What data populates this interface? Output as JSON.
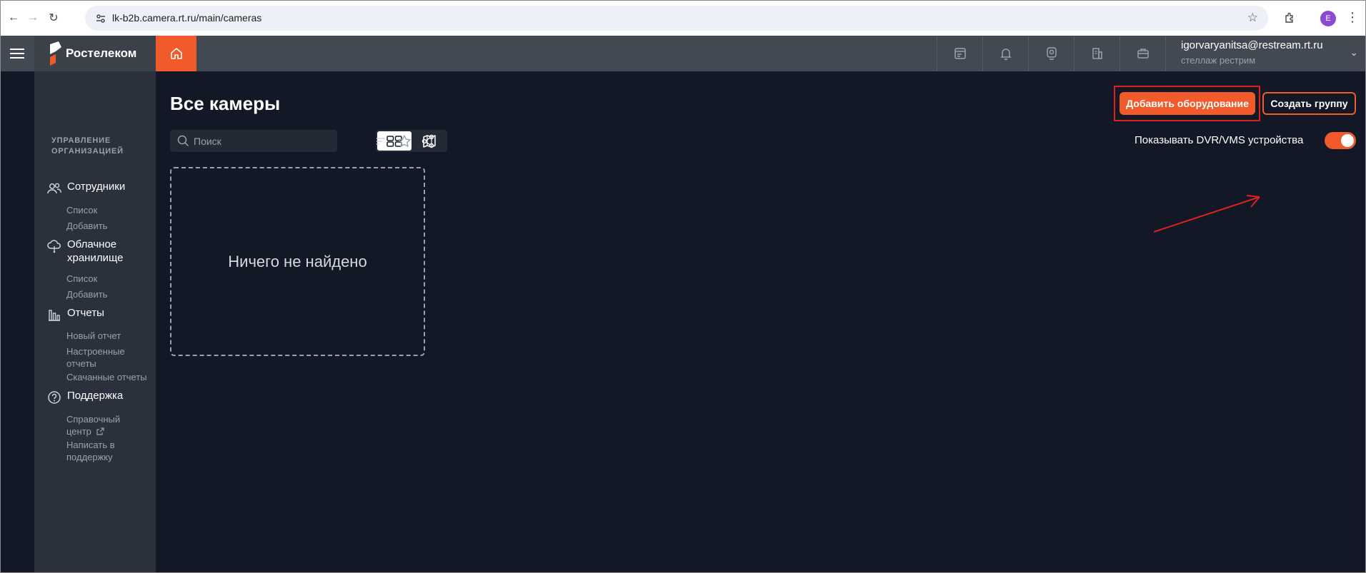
{
  "browser": {
    "url": "lk-b2b.camera.rt.ru/main/cameras",
    "profile_initial": "E"
  },
  "header": {
    "logo_text": "Ростелеком",
    "user_email": "igorvaryanitsa@restream.rt.ru",
    "user_org": "стеллаж рестрим"
  },
  "sidebar": {
    "title": "УПРАВЛЕНИЕ ОРГАНИЗАЦИЕЙ",
    "sections": [
      {
        "label": "Сотрудники",
        "icon": "users-icon",
        "links": [
          "Список",
          "Добавить"
        ]
      },
      {
        "label": "Облачное хранилище",
        "icon": "cloud-storage-icon",
        "links": [
          "Список",
          "Добавить"
        ]
      },
      {
        "label": "Отчеты",
        "icon": "reports-icon",
        "links": [
          "Новый отчет",
          "Настроенные отчеты",
          "Скачанные отчеты"
        ]
      },
      {
        "label": "Поддержка",
        "icon": "help-icon",
        "links": [
          "Справочный центр",
          "Написать в поддержку"
        ]
      }
    ]
  },
  "main": {
    "title": "Все камеры",
    "search_placeholder": "Поиск",
    "empty_text": "Ничего не найдено",
    "add_button": "Добавить оборудование",
    "group_button": "Создать группу",
    "dvr_toggle_label": "Показывать DVR/VMS устройства",
    "dvr_toggle_on": true
  },
  "colors": {
    "accent": "#f15b2b",
    "annotation": "#e02020",
    "background": "#121826"
  }
}
